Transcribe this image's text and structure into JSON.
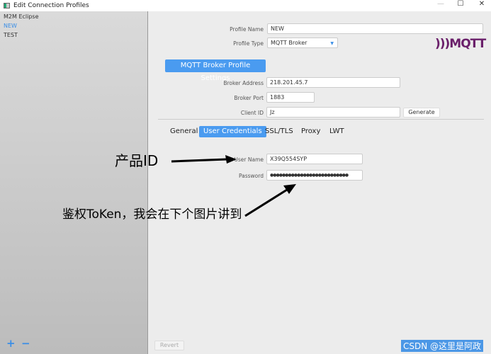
{
  "window": {
    "title": "Edit Connection Profiles",
    "minimize": "—",
    "maximize": "☐",
    "close": "✕"
  },
  "sidebar": {
    "items": [
      {
        "label": "M2M Eclipse"
      },
      {
        "label": "NEW",
        "selected": true
      },
      {
        "label": "TEST"
      }
    ],
    "add": "+",
    "remove": "−"
  },
  "form": {
    "profile_name_label": "Profile Name",
    "profile_name": "NEW",
    "profile_type_label": "Profile Type",
    "profile_type": "MQTT Broker",
    "logo": "MQTT",
    "section_button": "MQTT Broker Profile Settings",
    "broker_address_label": "Broker Address",
    "broker_address": "218.201.45.7",
    "broker_port_label": "Broker Port",
    "broker_port": "1883",
    "client_id_label": "Client ID",
    "client_id": "Jz",
    "generate": "Generate"
  },
  "tabs": [
    {
      "label": "General"
    },
    {
      "label": "User Credentials",
      "active": true
    },
    {
      "label": "SSL/TLS"
    },
    {
      "label": "Proxy"
    },
    {
      "label": "LWT"
    }
  ],
  "credentials": {
    "user_name_label": "User Name",
    "user_name": "X39Q554SYP",
    "password_label": "Password",
    "password": "●●●●●●●●●●●●●●●●●●●●●●●●●●"
  },
  "annotations": {
    "product_id": "产品ID",
    "token": "鉴权ToKen，我会在下个图片讲到"
  },
  "footer": {
    "revert": "Revert"
  },
  "watermark": "CSDN @这里是阿政",
  "colors": {
    "accent": "#4a9bf0"
  }
}
